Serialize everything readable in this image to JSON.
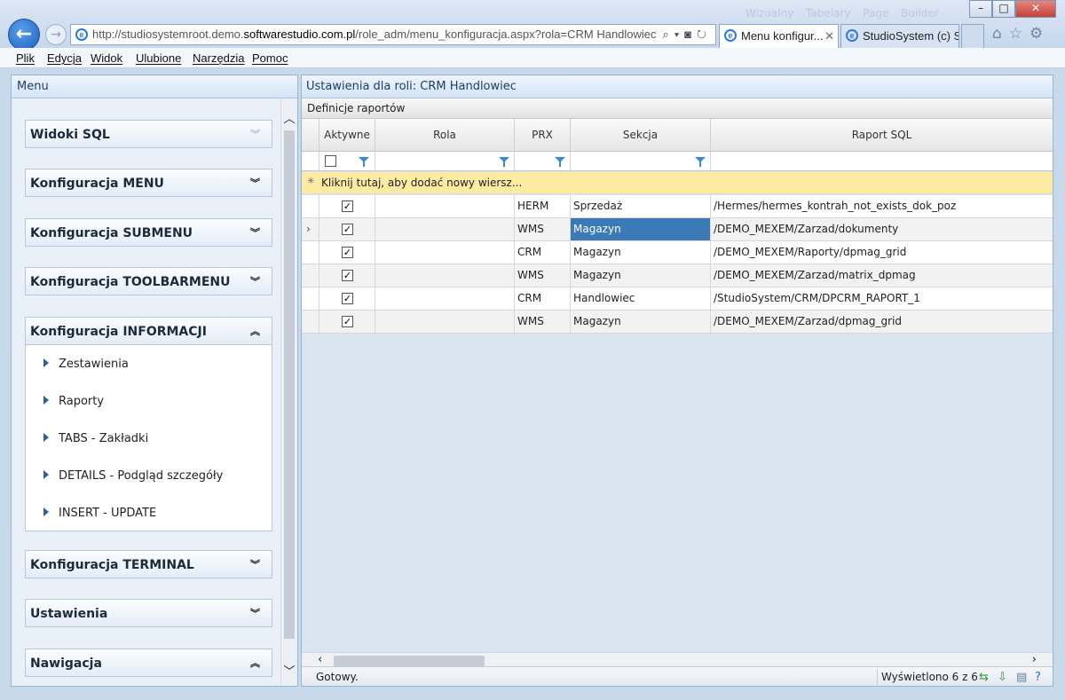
{
  "browser": {
    "url_prefix": "http://studiosystemroot.demo.",
    "url_host": "softwarestudio.com.pl",
    "url_suffix": "/role_adm/menu_konfiguracja.aspx?rola=CRM Handlowiec",
    "tabs": [
      {
        "label": "Menu konfigur...",
        "active": true
      },
      {
        "label": "StudioSystem (c) S...",
        "active": false
      }
    ],
    "menu": [
      "Plik",
      "Edycja",
      "Widok",
      "Ulubione",
      "Narzędzia",
      "Pomoc"
    ]
  },
  "left_panel": {
    "title": "Menu",
    "groups": [
      {
        "label": "Widoki SQL",
        "chevron": "»"
      },
      {
        "label": "Konfiguracja MENU",
        "chevron": "»"
      },
      {
        "label": "Konfiguracja SUBMENU",
        "chevron": "»"
      },
      {
        "label": "Konfiguracja TOOLBARMENU",
        "chevron": "»"
      },
      {
        "label": "Konfiguracja INFORMACJI",
        "chevron": "«"
      },
      {
        "label": "Konfiguracja TERMINAL",
        "chevron": "»"
      },
      {
        "label": "Ustawienia",
        "chevron": "»"
      },
      {
        "label": "Nawigacja",
        "chevron": "«"
      }
    ],
    "info_items": [
      "Zestawienia",
      "Raporty",
      "TABS - Zakładki",
      "DETAILS - Podgląd szczegóły",
      "INSERT - UPDATE"
    ]
  },
  "right_panel": {
    "title": "Ustawienia dla roli: CRM Handlowiec",
    "caption": "Definicje raportów",
    "columns": [
      "Aktywne",
      "Rola",
      "PRX",
      "Sekcja",
      "Raport SQL"
    ],
    "add_row_text": "Kliknij tutaj, aby dodać nowy wiersz...",
    "rows": [
      {
        "active": true,
        "rola": "",
        "prx": "HERM",
        "sekcja": "Sprzedaż",
        "raport": "/Hermes/hermes_kontrah_not_exists_dok_poz"
      },
      {
        "active": true,
        "rola": "",
        "prx": "WMS",
        "sekcja": "Magazyn",
        "raport": "/DEMO_MEXEM/Zarzad/dokumenty"
      },
      {
        "active": true,
        "rola": "",
        "prx": "CRM",
        "sekcja": "Magazyn",
        "raport": "/DEMO_MEXEM/Raporty/dpmag_grid"
      },
      {
        "active": true,
        "rola": "",
        "prx": "WMS",
        "sekcja": "Magazyn",
        "raport": "/DEMO_MEXEM/Zarzad/matrix_dpmag"
      },
      {
        "active": true,
        "rola": "",
        "prx": "CRM",
        "sekcja": "Handlowiec",
        "raport": "/StudioSystem/CRM/DPCRM_RAPORT_1"
      },
      {
        "active": true,
        "rola": "",
        "prx": "WMS",
        "sekcja": "Magazyn",
        "raport": "/DEMO_MEXEM/Zarzad/dpmag_grid"
      }
    ],
    "status_ready": "Gotowy.",
    "status_count": "Wyświetlono 6 z 6"
  },
  "colors": {
    "selected_cell": "#3b7ab7",
    "new_row": "#fdeaa3",
    "panel_header_text": "#1b3e6f"
  }
}
